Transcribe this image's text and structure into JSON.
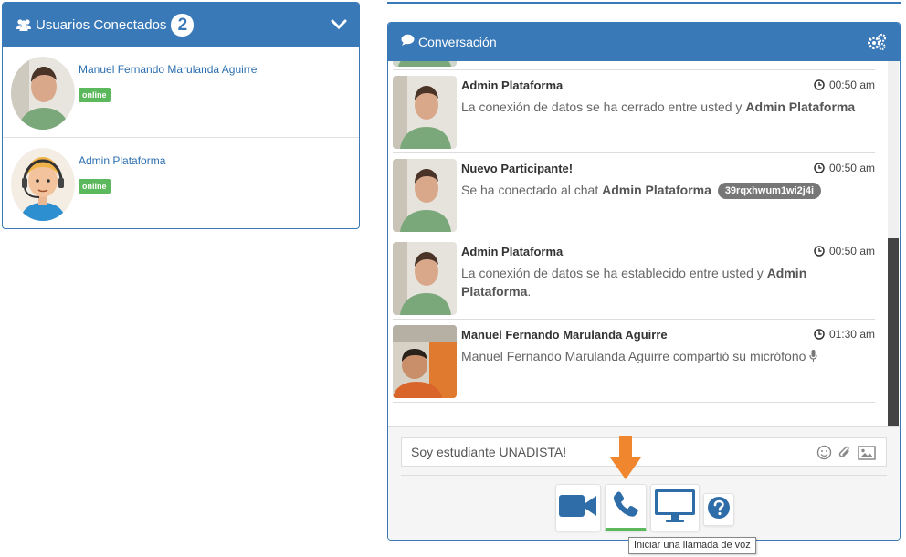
{
  "users_panel": {
    "title": "Usuarios Conectados",
    "count": "2",
    "icons": {
      "header": "users-icon",
      "toggle": "chevron-down-icon"
    },
    "users": [
      {
        "name": "Manuel Fernando Marulanda Aguirre",
        "status": "online",
        "avatar": "photo-man-green-shirt"
      },
      {
        "name": "Admin Plataforma",
        "status": "online",
        "avatar": "cartoon-operator-headset"
      }
    ]
  },
  "conversation": {
    "title": "Conversación",
    "icons": {
      "header": "chat-bubble-icon",
      "settings": "gears-icon"
    },
    "messages": [
      {
        "sender": "Admin Plataforma",
        "time": "00:50 am",
        "text_pre": "La conexión de datos se ha cerrado entre usted y ",
        "text_bold": "Admin Plataforma",
        "text_post": ""
      },
      {
        "sender": "Nuevo Participante!",
        "time": "00:50 am",
        "text_pre": "Se ha conectado al chat ",
        "text_bold": "Admin Plataforma",
        "pill": "39rqxhwum1wi2j4i"
      },
      {
        "sender": "Admin Plataforma",
        "time": "00:50 am",
        "text_pre": "La conexión de datos se ha establecido entre usted y ",
        "text_bold": "Admin Plataforma",
        "text_post": "."
      },
      {
        "sender": "Manuel Fernando Marulanda Aguirre",
        "time": "01:30 am",
        "text_pre": "Manuel Fernando Marulanda Aguirre compartió su micrófono",
        "icon": "microphone-icon"
      }
    ],
    "input": {
      "value": "Soy estudiante UNADISTA!",
      "icons": [
        "smile-icon",
        "paperclip-icon",
        "image-icon"
      ]
    },
    "actions": [
      {
        "name": "video-call",
        "icon": "video-camera-icon"
      },
      {
        "name": "voice-call",
        "icon": "phone-icon",
        "active": true
      },
      {
        "name": "screen-share",
        "icon": "monitor-icon"
      },
      {
        "name": "help",
        "icon": "question-circle-icon"
      }
    ],
    "tooltip": "Iniciar una llamada de voz"
  },
  "colors": {
    "primary": "#3a79b8",
    "online": "#5cb85c",
    "arrow": "#f0862e",
    "pill": "#777777"
  }
}
